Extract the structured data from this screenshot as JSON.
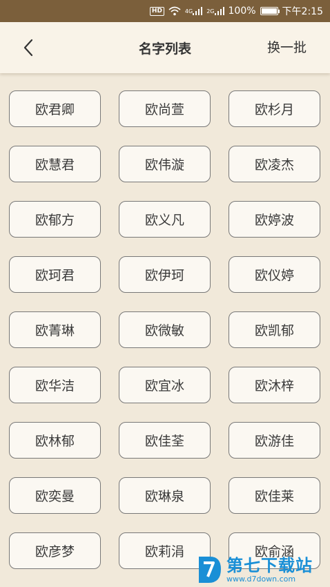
{
  "status_bar": {
    "hd": "HD",
    "net1": "4G",
    "net2": "2G",
    "battery": "100%",
    "time": "下午2:15",
    "battery_level": 1.0
  },
  "header": {
    "title": "名字列表",
    "refresh_label": "换一批"
  },
  "names": [
    "欧君卿",
    "欧尚萱",
    "欧杉月",
    "欧慧君",
    "欧伟漩",
    "欧凌杰",
    "欧郁方",
    "欧义凡",
    "欧婷波",
    "欧珂君",
    "欧伊珂",
    "欧仪婷",
    "欧菁琳",
    "欧微敏",
    "欧凯郁",
    "欧华洁",
    "欧宜冰",
    "欧沐梓",
    "欧林郁",
    "欧佳荃",
    "欧游佳",
    "欧奕曼",
    "欧琳泉",
    "欧佳莱",
    "欧彦梦",
    "欧莉涓",
    "欧俞涵"
  ],
  "watermark": {
    "title": "第七下载站",
    "url": "www.d7down.com"
  },
  "colors": {
    "status_bar": "#7b5f3b",
    "background": "#f1e9da",
    "header": "#f9f3e8",
    "button_border": "#777777",
    "watermark": "#1a8fd6"
  }
}
